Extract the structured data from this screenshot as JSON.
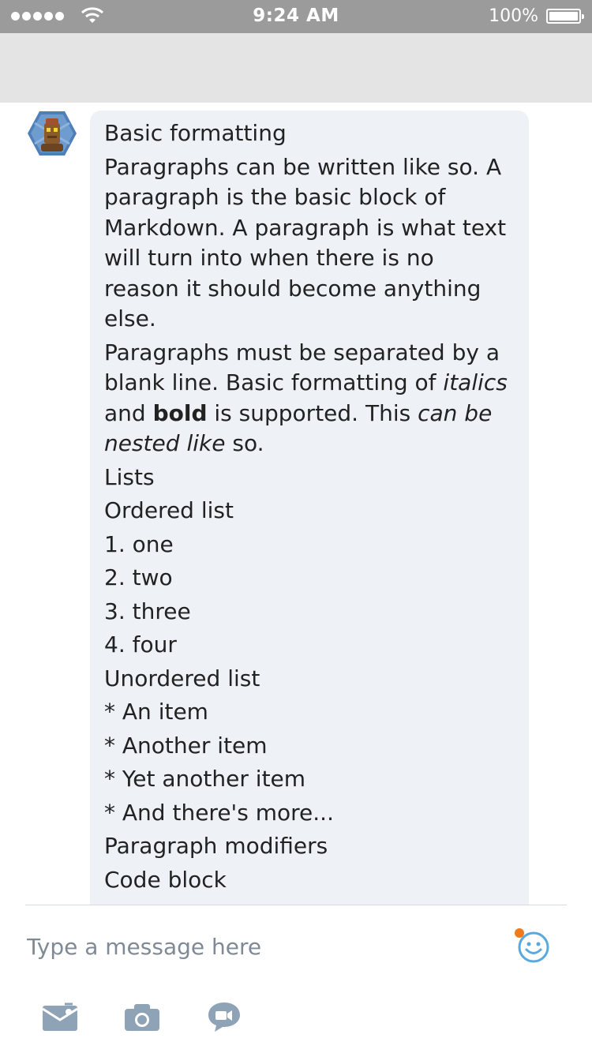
{
  "status_bar": {
    "time": "9:24 AM",
    "battery": "100%"
  },
  "message": {
    "title": "Basic formatting",
    "paragraph1": "Paragraphs can be written like so. A paragraph is the  basic block of Markdown.  A paragraph is what text will turn  into when there is no reason it should become anything else.",
    "p2_a": "Paragraphs must be separated by a blank line. Basic formatting of ",
    "p2_italics": "italics",
    "p2_b": " and ",
    "p2_bold": "bold",
    "p2_c": " is supported. This ",
    "p2_nested": "can be nested like",
    "p2_d": " so.",
    "lists_heading": "Lists",
    "ordered_heading": "Ordered list",
    "ordered_items": [
      "1. one",
      "2. two",
      "3. three",
      "4. four"
    ],
    "unordered_heading": "Unordered list",
    "unordered_items": [
      "* An item",
      "* Another item",
      "* Yet another item",
      "* And there's more..."
    ],
    "modifiers_heading": "Paragraph modifiers",
    "code_heading": "Code block"
  },
  "composer": {
    "placeholder": "Type a message here"
  },
  "colors": {
    "accent": "#5aa9dd",
    "icon_gray": "#8fa3b7",
    "notification_dot": "#f07a1c"
  },
  "icons": [
    "wifi-icon",
    "battery-icon",
    "avatar",
    "emoji-icon",
    "image-icon",
    "camera-icon",
    "video-message-icon"
  ]
}
